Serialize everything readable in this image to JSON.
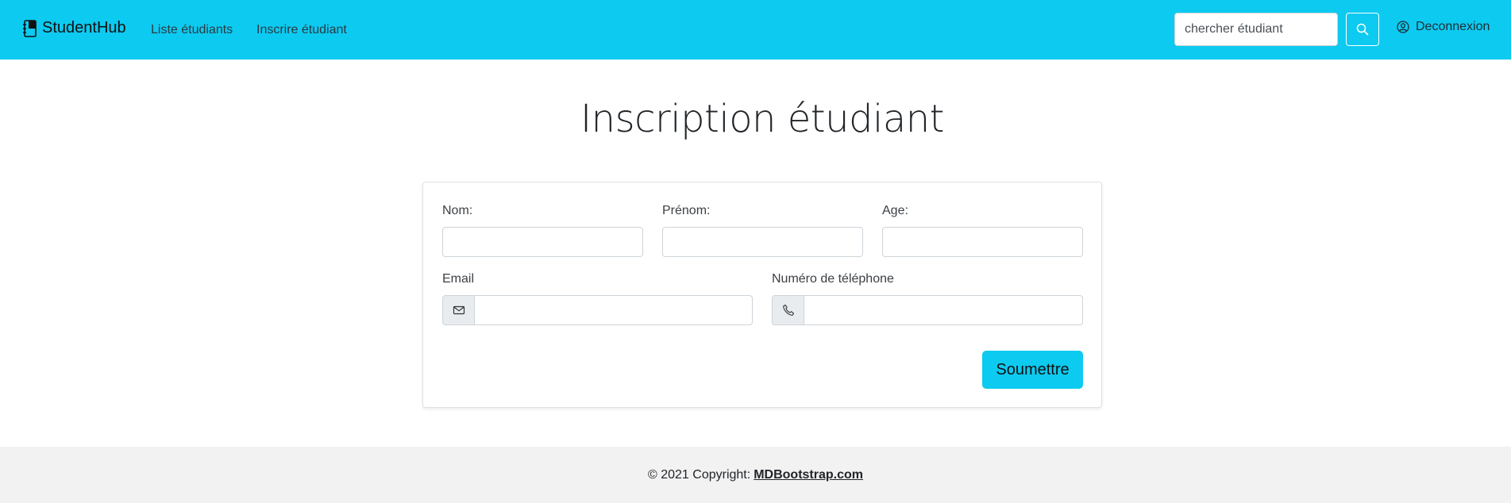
{
  "navbar": {
    "brand": "StudentHub",
    "links": [
      "Liste étudiants",
      "Inscrire étudiant"
    ],
    "search_placeholder": "chercher étudiant",
    "logout_label": "Deconnexion",
    "icons": {
      "brand": "notebook-icon",
      "search": "search-icon",
      "logout": "user-circle-icon"
    },
    "background": "#0dcaf0"
  },
  "page": {
    "title": "Inscription étudiant"
  },
  "form": {
    "nom_label": "Nom:",
    "nom_value": "",
    "prenom_label": "Prénom:",
    "prenom_value": "",
    "age_label": "Age:",
    "age_value": "",
    "email_label": "Email",
    "email_value": "",
    "phone_label": "Numéro de téléphone",
    "phone_value": "",
    "icons": {
      "email": "envelope-icon",
      "phone": "phone-icon"
    },
    "submit_label": "Soumettre"
  },
  "footer": {
    "copyright": "© 2021 Copyright:",
    "link": "MDBootstrap.com"
  }
}
